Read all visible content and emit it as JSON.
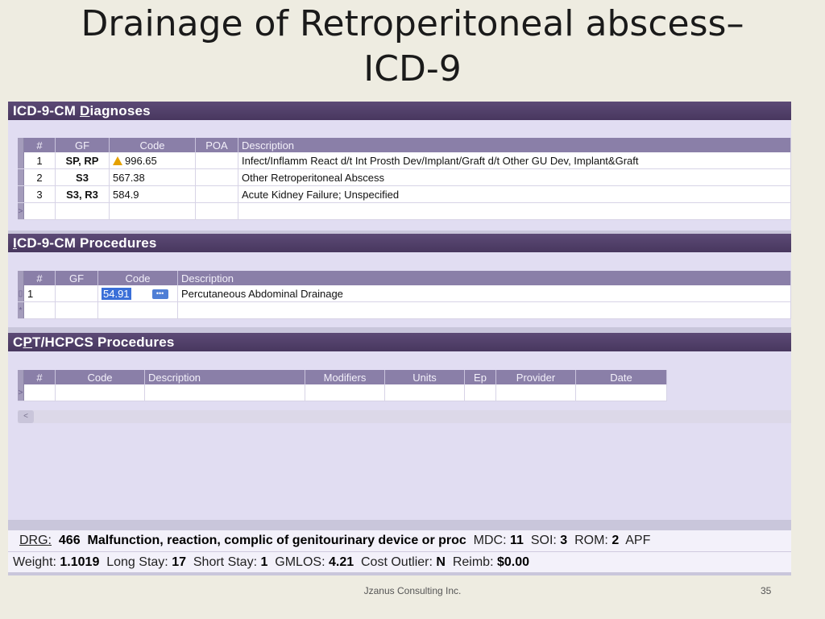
{
  "slide": {
    "title_line1": "Drainage of Retroperitoneal abscess–",
    "title_line2": "ICD-9",
    "footer": "Jzanus Consulting Inc.",
    "page_number": "35"
  },
  "diagnoses": {
    "title_prefix": "ICD-9-CM ",
    "title_underlined": "D",
    "title_suffix": "iagnoses",
    "headers": [
      "#",
      "GF",
      "Code",
      "POA",
      "Description"
    ],
    "rows": [
      {
        "num": "1",
        "gf": "SP, RP",
        "code": "996.65",
        "poa": "",
        "desc": "Infect/Inflamm React d/t Int Prosth Dev/Implant/Graft d/t Other GU Dev, Implant&Graft",
        "warning": true
      },
      {
        "num": "2",
        "gf": "S3",
        "code": "567.38",
        "poa": "",
        "desc": "Other Retroperitoneal Abscess"
      },
      {
        "num": "3",
        "gf": "S3, R3",
        "code": "584.9",
        "poa": "",
        "desc": "Acute Kidney Failure; Unspecified"
      }
    ]
  },
  "procedures": {
    "title_underlined": "I",
    "title_suffix": "CD-9-CM Procedures",
    "headers": [
      "#",
      "GF",
      "Code",
      "Description"
    ],
    "rows": [
      {
        "num": "1",
        "gf": "",
        "code": "54.91",
        "desc": "Percutaneous Abdominal Drainage"
      }
    ]
  },
  "cpt": {
    "title_prefix": "C",
    "title_underlined": "P",
    "title_suffix": "T/HCPCS Procedures",
    "headers": [
      "#",
      "Code",
      "Description",
      "Modifiers",
      "Units",
      "Ep",
      "Provider",
      "Date"
    ]
  },
  "status": {
    "drg_label": "DRG:",
    "drg_value": "466",
    "drg_desc": "Malfunction, reaction, complic of genitourinary device or proc",
    "mdc_label": "MDC:",
    "mdc_value": "11",
    "soi_label": "SOI:",
    "soi_value": "3",
    "rom_label": "ROM:",
    "rom_value": "2",
    "apr_label": "APF",
    "weight_label": "Weight:",
    "weight_value": "1.1019",
    "long_stay_label": "Long Stay:",
    "long_stay_value": "17",
    "short_stay_label": "Short Stay:",
    "short_stay_value": "1",
    "gmlos_label": "GMLOS:",
    "gmlos_value": "4.21",
    "cost_outlier_label": "Cost Outlier:",
    "cost_outlier_value": "N",
    "reimb_label": "Reimb:",
    "reimb_value": "$0.00"
  }
}
